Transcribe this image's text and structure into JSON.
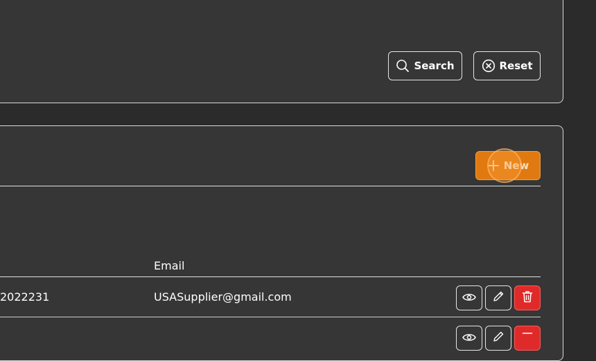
{
  "filter": {
    "search_label": "Search",
    "reset_label": "Reset"
  },
  "toolbar": {
    "new_label": "New"
  },
  "table": {
    "columns": {
      "email": "Email"
    },
    "rows": [
      {
        "phone_fragment": "2022231",
        "email": "USASupplier@gmail.com"
      },
      {
        "phone_fragment": "",
        "email": ""
      }
    ]
  },
  "icons": {
    "search": "search-icon",
    "reset": "close-circle-icon",
    "new": "plus-icon",
    "view": "eye-icon",
    "edit": "pencil-icon",
    "delete": "trash-icon"
  },
  "colors": {
    "background": "#2b2b2b",
    "panel": "#363636",
    "accent": "#e07a10",
    "danger": "#e02a2a"
  }
}
